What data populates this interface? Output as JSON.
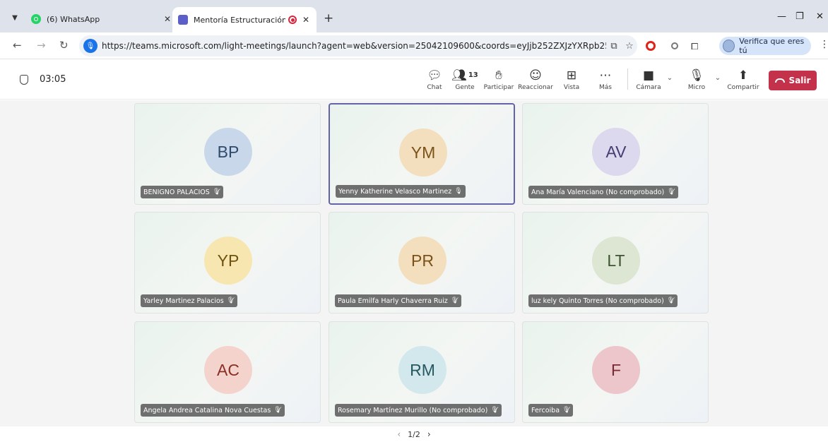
{
  "browser": {
    "tabs": [
      {
        "title": "(6) WhatsApp",
        "icon": "whatsapp-icon",
        "active": false
      },
      {
        "title": "Mentoría Estructuración de",
        "icon": "teams-icon",
        "active": true
      }
    ],
    "url": "https://teams.microsoft.com/light-meetings/launch?agent=web&version=25042109600&coords=eyJjb252ZXJzYXRpb25JZCI6IjE...",
    "profile_label": "Verifica que eres tú"
  },
  "meeting": {
    "timer": "03:05",
    "toolbar": {
      "chat": "Chat",
      "people": "Gente",
      "people_count": "13",
      "raise": "Participar",
      "react": "Reaccionar",
      "view": "Vista",
      "more": "Más",
      "camera": "Cámara",
      "mic": "Micro",
      "share": "Compartir",
      "leave": "Salir"
    },
    "colors": {
      "leave_red": "#c4314b",
      "speaking_border": "#6264a7"
    },
    "participants": [
      {
        "initials": "BP",
        "name": "BENIGNO PALACIOS",
        "muted": true,
        "speaking": false,
        "bg": "#c8d8ea",
        "fg": "#2f4a6d"
      },
      {
        "initials": "YM",
        "name": "Yenny Katherine Velasco Martinez",
        "muted": false,
        "speaking": true,
        "bg": "#f3dfbd",
        "fg": "#7a531a"
      },
      {
        "initials": "AV",
        "name": "Ana María Valenciano (No comprobado)",
        "muted": true,
        "speaking": false,
        "bg": "#dcd8ee",
        "fg": "#433d70"
      },
      {
        "initials": "YP",
        "name": "Yarley Martinez Palacios",
        "muted": true,
        "speaking": false,
        "bg": "#f8e6b0",
        "fg": "#6e5310"
      },
      {
        "initials": "PR",
        "name": "Paula Emilfa Harly Chaverra Ruiz",
        "muted": true,
        "speaking": false,
        "bg": "#f3dfbd",
        "fg": "#7a531a"
      },
      {
        "initials": "LT",
        "name": "luz kely Quinto Torres (No comprobado)",
        "muted": true,
        "speaking": false,
        "bg": "#dde6d2",
        "fg": "#3f5231"
      },
      {
        "initials": "AC",
        "name": "Angela Andrea Catalina Nova Cuestas",
        "muted": true,
        "speaking": false,
        "bg": "#f5d3cd",
        "fg": "#8a2f24"
      },
      {
        "initials": "RM",
        "name": "Rosemary Martínez Murillo (No comprobado)",
        "muted": true,
        "speaking": false,
        "bg": "#d3e8ec",
        "fg": "#265861"
      },
      {
        "initials": "F",
        "name": "Fercoiba",
        "muted": true,
        "speaking": false,
        "bg": "#ecc6ca",
        "fg": "#7a2a35"
      }
    ],
    "pagination": "1/2"
  }
}
